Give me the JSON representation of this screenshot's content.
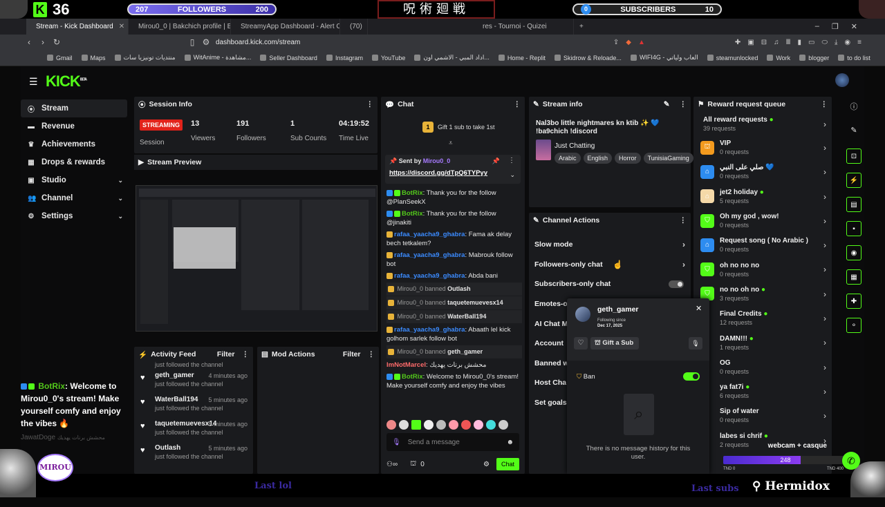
{
  "overlay": {
    "kick_count": "36",
    "followers_left": "207",
    "followers_label": "FOLLOWERS",
    "followers_right": "200",
    "subscribers_left": "0",
    "subscribers_label": "SUBSCRIBERS",
    "subscribers_right": "10",
    "botrix_msg_name": "BotRix",
    "botrix_msg_text": ": Welcome to Mirou0_0's stream! Make yourself comfy and enjoy the vibes",
    "botrix_msg_faded": "محشش برنات يهديك",
    "botrix_msg_faded_name": "JawatDoge",
    "brand_bottom": "Hermidox",
    "avatar_text": "MIROU",
    "ad_left": "Last lol",
    "ad_right": "Last subs",
    "goal_label": "webcam + casque",
    "goal_value": "248",
    "goal_left": "TND 0",
    "goal_right": "TND 400",
    "goal_progress": 0.62
  },
  "browser": {
    "tabs": [
      {
        "label": "Stream - Kick Dashboard",
        "active": true
      },
      {
        "label": "Mirou0_0 | Bakchich profile | Bakchi",
        "active": false
      },
      {
        "label": "StreamyApp Dashboard - Alert Confi",
        "active": false
      },
      {
        "label": "(70)",
        "active": false
      },
      {
        "label": "res - Tournoi - Quizei",
        "active": false
      }
    ],
    "url": "dashboard.kick.com/stream",
    "bookmarks": [
      "Gmail",
      "Maps",
      "منتديات تونيزيا سات",
      "WitAnime - مشاهدة...",
      "Seller Dashboard",
      "Instagram",
      "YouTube",
      "اداد المبي - الاشمي اون...",
      "Home - Replit",
      "Skidrow & Reloade...",
      "WIFI4G - العاب ولياتي",
      "steamunlocked",
      "Work",
      "blogger",
      "to do list"
    ]
  },
  "sidebar": {
    "logo": "KICK",
    "logo_tag": "BETA",
    "items": [
      {
        "label": "Stream",
        "icon": "radio-icon",
        "active": true,
        "chevron": false
      },
      {
        "label": "Revenue",
        "icon": "money-icon",
        "active": false,
        "chevron": false
      },
      {
        "label": "Achievements",
        "icon": "trophy-icon",
        "active": false,
        "chevron": false
      },
      {
        "label": "Drops & rewards",
        "icon": "gift-icon",
        "active": false,
        "chevron": false
      },
      {
        "label": "Studio",
        "icon": "studio-icon",
        "active": false,
        "chevron": true
      },
      {
        "label": "Channel",
        "icon": "people-icon",
        "active": false,
        "chevron": true
      },
      {
        "label": "Settings",
        "icon": "gear-icon",
        "active": false,
        "chevron": true
      }
    ]
  },
  "session": {
    "title": "Session Info",
    "status": "STREAMING",
    "session_label": "Session",
    "stats": [
      {
        "value": "13",
        "label": "Viewers"
      },
      {
        "value": "191",
        "label": "Followers"
      },
      {
        "value": "1",
        "label": "Sub Counts"
      },
      {
        "value": "04:19:52",
        "label": "Time Live"
      }
    ]
  },
  "preview": {
    "title": "Stream Preview"
  },
  "activity": {
    "title": "Activity Feed",
    "filter": "Filter",
    "top_partial": "just followed the channel",
    "rows": [
      {
        "name": "geth_gamer",
        "time": "4 minutes ago",
        "text": "just followed the channel"
      },
      {
        "name": "WaterBall194",
        "time": "5 minutes ago",
        "text": "just followed the channel"
      },
      {
        "name": "taquetemuevesx14",
        "time": "5 minutes ago",
        "text": "just followed the channel"
      },
      {
        "name": "Outlash",
        "time": "5 minutes ago",
        "text": "just followed the channel"
      }
    ]
  },
  "mod": {
    "title": "Mod Actions",
    "filter": "Filter"
  },
  "chat": {
    "title": "Chat",
    "gift_text": "Gift 1 sub to take 1st",
    "gift_count": "1",
    "pinned_label": "Sent by",
    "pinned_user": "Mirou0_0",
    "pinned_link": "https://discord.gg/dTpQ6TYPyy",
    "messages": [
      {
        "kind": "msg",
        "name": "BotRix",
        "color": "green",
        "text": ": Thank you for the follow @PlanSeekX"
      },
      {
        "kind": "msg",
        "name": "BotRix",
        "color": "green",
        "text": ": Thank you for the follow @jinakiti"
      },
      {
        "kind": "msg",
        "name": "rafaa_yaacha9_ghabra",
        "color": "blue",
        "text": ": Fama ak delay bech tetkalem?"
      },
      {
        "kind": "msg",
        "name": "rafaa_yaacha9_ghabra",
        "color": "blue",
        "text": ": Mabrouk follow bot"
      },
      {
        "kind": "msg",
        "name": "rafaa_yaacha9_ghabra",
        "color": "blue",
        "text": ": Abda bani"
      },
      {
        "kind": "ban",
        "name": "Mirou0_0",
        "text": "banned",
        "target": "Outlash"
      },
      {
        "kind": "ban",
        "name": "Mirou0_0",
        "text": "banned",
        "target": "taquetemuevesx14"
      },
      {
        "kind": "ban",
        "name": "Mirou0_0",
        "text": "banned",
        "target": "WaterBall194"
      },
      {
        "kind": "msg",
        "name": "rafaa_yaacha9_ghabra",
        "color": "blue",
        "text": ": Abaath lel kick golhom sarlek follow bot"
      },
      {
        "kind": "ban",
        "name": "Mirou0_0",
        "text": "banned",
        "target": "geth_gamer"
      },
      {
        "kind": "msg",
        "name": "ImNotMarcel",
        "color": "green",
        "text": ": محشش برنات يهديك"
      },
      {
        "kind": "msg",
        "name": "BotRix",
        "color": "green",
        "text": ": Welcome to Mirou0_0's stream! Make yourself comfy and enjoy the vibes"
      }
    ],
    "placeholder": "Send a message",
    "footer_count": "0",
    "send_label": "Chat"
  },
  "stream_info": {
    "title": "Stream info",
    "stream_title": "Nal3bo little nightmares kn ktib ✨ 💙 !ba9chich !discord",
    "category": "Just Chatting",
    "tags": [
      "Arabic",
      "English",
      "Horror",
      "TunisiaGaming"
    ]
  },
  "channel_actions": {
    "title": "Channel Actions",
    "rows": [
      "Slow mode",
      "Followers-only chat",
      "Subscribers-only chat",
      "Emotes-o",
      "AI Chat M",
      "Account",
      "Banned w",
      "Host Cha",
      "Set goals"
    ]
  },
  "user_card": {
    "username": "geth_gamer",
    "following_label": "Following since",
    "following_date": "Dec 17, 2025",
    "gift_label": "Gift a Sub",
    "ban_label": "Ban",
    "empty_text": "There is no message history for this user."
  },
  "rewards": {
    "title": "Reward request queue",
    "all_label": "All reward requests",
    "all_count": "39 requests",
    "items": [
      {
        "name": "VIP",
        "count": "0 requests",
        "color": "#f39a1e",
        "dot": false
      },
      {
        "name": "صلي على النبي 💙",
        "count": "0 requests",
        "color": "#2d8cf0",
        "dot": false
      },
      {
        "name": "jet2 holiday",
        "count": "5 requests",
        "color": "#f5d9a8",
        "dot": true
      },
      {
        "name": "Oh my god , wow!",
        "count": "0 requests",
        "color": "#53fc18",
        "dot": false
      },
      {
        "name": "Request song ( No Arabic )",
        "count": "0 requests",
        "color": "#2d8cf0",
        "dot": false
      },
      {
        "name": "oh no no no",
        "count": "0 requests",
        "color": "#53fc18",
        "dot": false
      },
      {
        "name": "no no oh no",
        "count": "3 requests",
        "color": "#53fc18",
        "dot": true
      },
      {
        "name": "Final Credits",
        "count": "12 requests",
        "color": "#53fc18",
        "dot": true
      },
      {
        "name": "DAMN!!!",
        "count": "1 requests",
        "color": "#53fc18",
        "dot": true
      },
      {
        "name": "OG",
        "count": "0 requests",
        "color": "#53fc18",
        "dot": false
      },
      {
        "name": "ya fat7i",
        "count": "6 requests",
        "color": "#53fc18",
        "dot": true
      },
      {
        "name": "Sip of water",
        "count": "0 requests",
        "color": "#53fc18",
        "dot": false
      },
      {
        "name": "labes si chrif",
        "count": "2 requests",
        "color": "#53fc18",
        "dot": true
      }
    ]
  },
  "rail": [
    "info-icon",
    "pencil-icon",
    "camera-icon",
    "bolt-icon",
    "notes-icon",
    "chat-icon",
    "broadcast-icon",
    "grid-icon",
    "wrench-icon",
    "nodes-icon"
  ]
}
